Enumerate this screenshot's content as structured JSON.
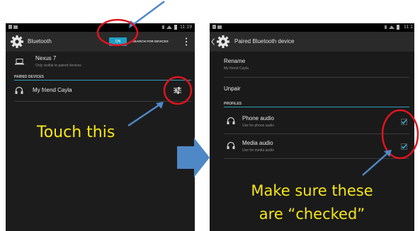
{
  "colors": {
    "annotation_text": "#f7e61a",
    "annotation_circle": "#e0141e",
    "annotation_arrow": "#4f88c6",
    "toggle_on": "#1d9fc5",
    "check": "#35b3e6"
  },
  "left_screen": {
    "status_time": "11:19",
    "action_bar": {
      "title": "Bluetooth",
      "toggle_label": "ON",
      "search_label": "SEARCH FOR DEVICES",
      "overflow_icon": "more-vert-icon"
    },
    "this_device": {
      "name": "Nexus 7",
      "subtitle": "Only visible to paired devices"
    },
    "paired_header": "PAIRED DEVICES",
    "paired_device": {
      "name": "My friend Cayla",
      "icon": "headset-icon",
      "settings_icon": "sliders-icon"
    }
  },
  "right_screen": {
    "status_time": "11:1",
    "action_bar": {
      "title": "Paired Bluetooth device"
    },
    "rename": {
      "title": "Rename",
      "value": "My friend Cayla"
    },
    "unpair_label": "Unpair",
    "profiles_header": "PROFILES",
    "profiles": [
      {
        "title": "Phone audio",
        "subtitle": "Use for phone audio",
        "checked": true
      },
      {
        "title": "Media audio",
        "subtitle": "Use for media audio",
        "checked": true
      }
    ]
  },
  "annotations": {
    "touch_this": "Touch this",
    "make_sure_line1": "Make sure these",
    "make_sure_line2": "are “checked”"
  }
}
